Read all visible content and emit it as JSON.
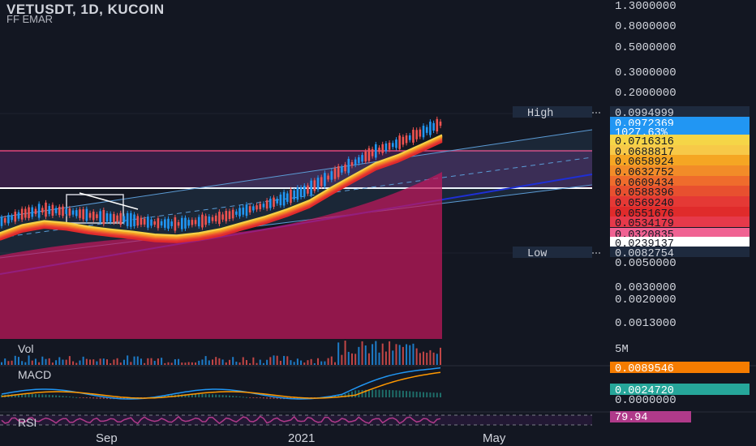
{
  "header": {
    "title": "VETUSDT, 1D, KUCOIN",
    "indicator": "FF EMAR"
  },
  "panes": {
    "vol": "Vol",
    "macd": "MACD",
    "rsi": "RSI"
  },
  "price_axis": [
    "1.3000000",
    "0.8000000",
    "0.5000000",
    "0.3000000",
    "0.2000000",
    "0.0050000",
    "0.0030000",
    "0.0020000",
    "0.0013000"
  ],
  "price_tags": [
    {
      "label": "High",
      "value": "0.0994999",
      "bg": "#1e2a3e",
      "fg": "#d1d4dc"
    },
    {
      "value": "0.0972369",
      "bg": "#2196f3",
      "fg": "#ffffff"
    },
    {
      "value": "1027.63%",
      "bg": "#2196f3",
      "fg": "#ffffff"
    },
    {
      "value": "0.0716316",
      "bg": "#f5d547",
      "fg": "#131722"
    },
    {
      "value": "0.0688817",
      "bg": "#f7c948",
      "fg": "#131722"
    },
    {
      "value": "0.0658924",
      "bg": "#f5a623",
      "fg": "#131722"
    },
    {
      "value": "0.0632752",
      "bg": "#f28c28",
      "fg": "#131722"
    },
    {
      "value": "0.0609434",
      "bg": "#ef6c2c",
      "fg": "#131722"
    },
    {
      "value": "0.0588396",
      "bg": "#e8502f",
      "fg": "#131722"
    },
    {
      "value": "0.0569240",
      "bg": "#e53935",
      "fg": "#131722"
    },
    {
      "value": "0.0551676",
      "bg": "#e02b2b",
      "fg": "#131722"
    },
    {
      "value": "0.0534179",
      "bg": "#e6394a",
      "fg": "#131722"
    },
    {
      "value": "0.0320835",
      "bg": "#f06292",
      "fg": "#131722"
    },
    {
      "value": "0.0239137",
      "bg": "#ffffff",
      "fg": "#131722"
    },
    {
      "label": "Low",
      "value": "0.0082754",
      "bg": "#1e2a3e",
      "fg": "#d1d4dc"
    }
  ],
  "vol_axis": "5M",
  "macd_axis": [
    "0.0089546",
    "0.0024720",
    "0.0000000"
  ],
  "rsi_axis": "79.94",
  "x_labels": [
    "Sep",
    "2021",
    "May"
  ],
  "colors": {
    "up": "#2196f3",
    "down": "#ef5350",
    "range_box": "#7b2f86",
    "channel": "#5b9bd5",
    "trend": "#1e2fd6",
    "area": "#c2185b",
    "macd": "#2196f3",
    "signal": "#ff9800",
    "rsi": "#b03a8a"
  },
  "chart_data": {
    "type": "line",
    "title": "VETUSDT, 1D, KUCOIN",
    "ylabel": "",
    "xlabel": "",
    "x_ticks": [
      "Sep",
      "2021",
      "May"
    ],
    "series": [
      {
        "name": "FF EMAR",
        "values": [
          0.0118,
          0.0136,
          0.0146,
          0.0141,
          0.0132,
          0.0126,
          0.0121,
          0.0115,
          0.0113,
          0.0118,
          0.0127,
          0.0142,
          0.0158,
          0.018,
          0.021,
          0.0265,
          0.033,
          0.041,
          0.047,
          0.056,
          0.067
        ]
      }
    ],
    "high": 0.0994999,
    "low": 0.0082754,
    "last": 0.0972369,
    "change_pct": "1027.63%",
    "macd_last": 0.0089546,
    "signal_last": 0.002472,
    "rsi_last": 79.94
  }
}
